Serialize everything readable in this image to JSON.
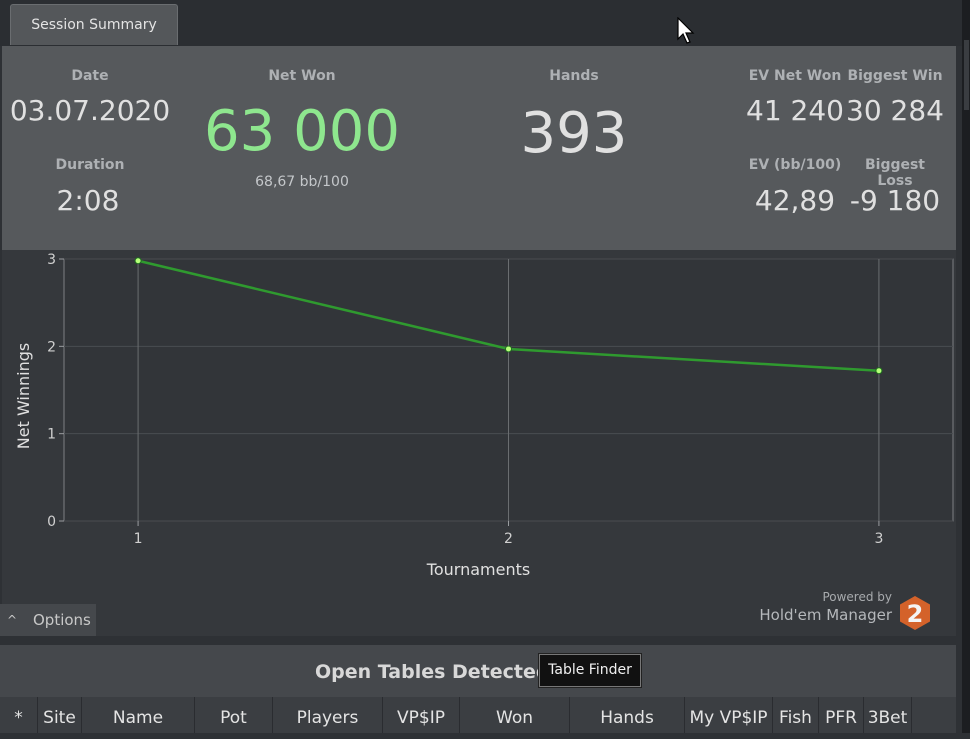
{
  "tab": {
    "label": "Session Summary"
  },
  "summary": {
    "date_label": "Date",
    "date": "03.07.2020",
    "duration_label": "Duration",
    "duration": "2:08",
    "net_won_label": "Net Won",
    "net_won": "63 000",
    "bb100": "68,67 bb/100",
    "hands_label": "Hands",
    "hands": "393",
    "ev_net_won_label": "EV Net Won",
    "ev_net_won": "41 240",
    "biggest_win_label": "Biggest Win",
    "biggest_win": "30 284",
    "ev_bb100_label": "EV (bb/100)",
    "ev_bb100": "42,89",
    "biggest_loss_label": "Biggest Loss",
    "biggest_loss": "-9 180"
  },
  "colors": {
    "net_won": "#8ee68e",
    "line": "#2f9a2f",
    "point": "#b6ff7a",
    "logo": "#d4622a"
  },
  "chart_data": {
    "type": "line",
    "title": "",
    "xlabel": "Tournaments",
    "ylabel": "Net Winnings",
    "x": [
      1,
      2,
      3
    ],
    "y": [
      2.98,
      1.97,
      1.72
    ],
    "xticks": [
      "1",
      "2",
      "3"
    ],
    "yticks": [
      "0",
      "1",
      "2",
      "3"
    ],
    "xlim": [
      0.8,
      3.2
    ],
    "ylim": [
      0,
      3
    ],
    "grid": true
  },
  "options": {
    "label": "Options",
    "caret": "^"
  },
  "branding": {
    "powered_by": "Powered by",
    "product": "Hold'em Manager",
    "logo_number": "2"
  },
  "tables": {
    "title": "Open Tables Detected",
    "finder_button": "Table Finder",
    "columns": [
      "*",
      "Site",
      "Name",
      "Pot",
      "Players",
      "VP$IP",
      "Won",
      "Hands",
      "My VP$IP",
      "Fish",
      "PFR",
      "3Bet"
    ]
  }
}
